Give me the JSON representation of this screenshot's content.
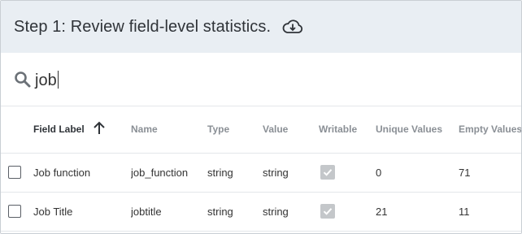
{
  "header": {
    "title": "Step 1: Review field-level statistics.",
    "download_icon": "cloud-download-icon"
  },
  "search": {
    "value": "job",
    "icon": "search-icon"
  },
  "table": {
    "columns": [
      {
        "label": "Field Label",
        "sorted": "ascending"
      },
      {
        "label": "Name"
      },
      {
        "label": "Type"
      },
      {
        "label": "Value"
      },
      {
        "label": "Writable"
      },
      {
        "label": "Unique Values"
      },
      {
        "label": "Empty Values"
      }
    ],
    "rows": [
      {
        "checked": false,
        "field_label": "Job function",
        "name": "job_function",
        "type": "string",
        "value": "string",
        "writable": true,
        "unique": "0",
        "empty": "71"
      },
      {
        "checked": false,
        "field_label": "Job Title",
        "name": "jobtitle",
        "type": "string",
        "value": "string",
        "writable": true,
        "unique": "21",
        "empty": "11"
      }
    ]
  },
  "colors": {
    "header_bg": "#e9eef3",
    "writable_check_bg": "#c4c7ca"
  }
}
